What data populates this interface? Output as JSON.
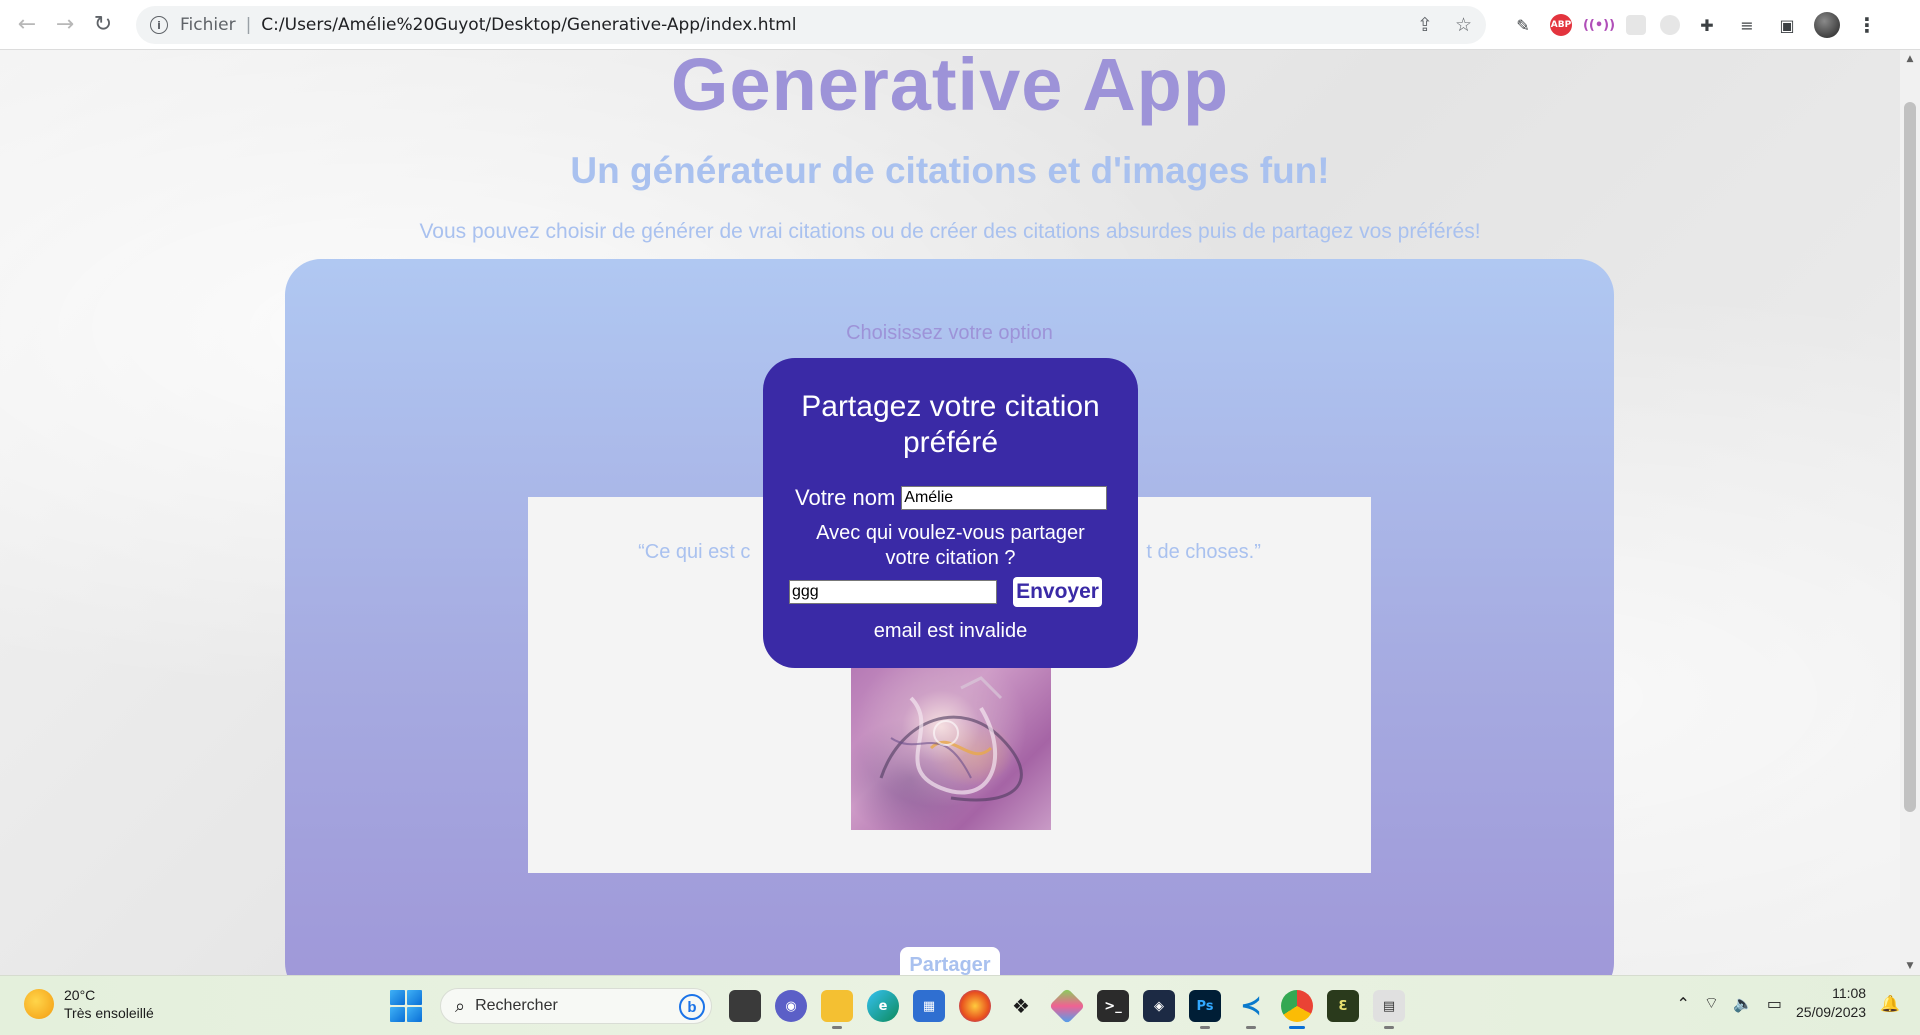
{
  "browser": {
    "scheme_label": "Fichier",
    "url": "C:/Users/Amélie%20Guyot/Desktop/Generative-App/index.html",
    "icons": [
      "back-arrow-icon",
      "forward-arrow-icon",
      "reload-icon",
      "info-icon",
      "share-icon",
      "star-icon",
      "eyedropper-icon",
      "adblock-icon",
      "radio-icon",
      "extension-icon",
      "puzzle-icon",
      "playlist-icon",
      "sidepanel-icon",
      "profile-avatar"
    ],
    "abp_label": "ABP"
  },
  "page": {
    "title": "Generative App",
    "subtitle": "Un générateur de citations et d'images fun!",
    "description": "Vous pouvez choisir de générer de vrai citations ou de créer des citations absurdes puis de partagez vos préférés!",
    "choose_label": "Choisissez votre option",
    "quote_left": "“Ce qui est c",
    "quote_right": "t de choses.”",
    "share_button": "Partager"
  },
  "modal": {
    "title": "Partagez votre citation préféré",
    "name_label": "Votre nom",
    "name_value": "Amélie",
    "question": "Avec qui voulez-vous partager votre citation ?",
    "email_value": "ggg",
    "send_button": "Envoyer",
    "error": "email est invalide"
  },
  "taskbar": {
    "temperature": "20°C",
    "weather": "Très ensoleillé",
    "search_placeholder": "Rechercher",
    "time": "11:08",
    "date": "25/09/2023"
  },
  "colors": {
    "title": "#9d93d8",
    "subtitle": "#a9c1ef",
    "modal_bg": "#3a2aa6"
  }
}
